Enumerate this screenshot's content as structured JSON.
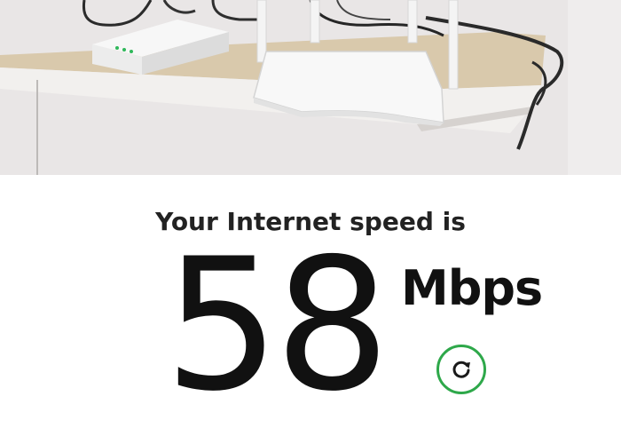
{
  "speed_test": {
    "headline": "Your Internet speed is",
    "value": "58",
    "unit": "Mbps"
  },
  "refresh_button": {
    "icon": "refresh-icon",
    "ring_color": "#2ea84a"
  },
  "photo": {
    "subject": "router-and-modem-on-shelf"
  }
}
